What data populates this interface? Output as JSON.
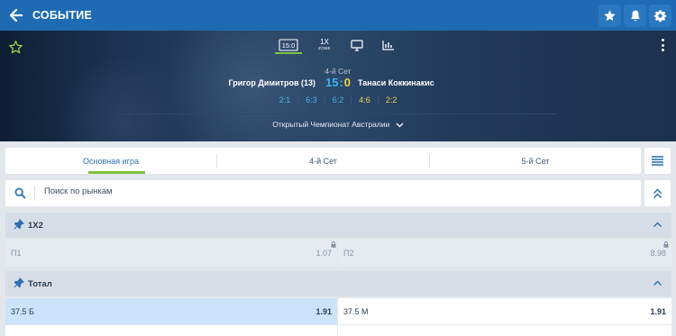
{
  "header": {
    "title": "СОБЫТИЕ"
  },
  "hero": {
    "tabs": [
      {
        "id": "score",
        "label": "15:0"
      },
      {
        "id": "1x",
        "label_top": "1X",
        "label_bottom": "ZONE"
      },
      {
        "id": "tv",
        "label": ""
      },
      {
        "id": "stats",
        "label": ""
      }
    ],
    "set_label": "4-й Сет",
    "player1": "Григор Димитров (13)",
    "player2": "Танаси Коккинакис",
    "score1": "15",
    "score_sep": ":",
    "score2": "0",
    "sets": [
      {
        "a": "2",
        "b": "1"
      },
      {
        "a": "6",
        "b": "3"
      },
      {
        "a": "6",
        "b": "2"
      },
      {
        "a": "4",
        "b": "6"
      },
      {
        "a": "2",
        "b": "2"
      }
    ],
    "tournament": "Открытый Чемпионат Австралии"
  },
  "tabs": [
    {
      "label": "Основная игра"
    },
    {
      "label": "4-й Сет"
    },
    {
      "label": "5-й Сет"
    }
  ],
  "search": {
    "placeholder": "Поиск по рынкам"
  },
  "markets": [
    {
      "title": "1X2",
      "odds": [
        {
          "label": "П1",
          "value": "1.07"
        },
        {
          "label": "П2",
          "value": "8.98"
        }
      ]
    },
    {
      "title": "Тотал",
      "odds": [
        {
          "label": "37.5 Б",
          "value": "1.91"
        },
        {
          "label": "37.5 М",
          "value": "1.91"
        }
      ]
    }
  ],
  "colors": {
    "brand": "#1f6bb3",
    "accent": "#7fc241",
    "selected": "#cbe4fb"
  }
}
